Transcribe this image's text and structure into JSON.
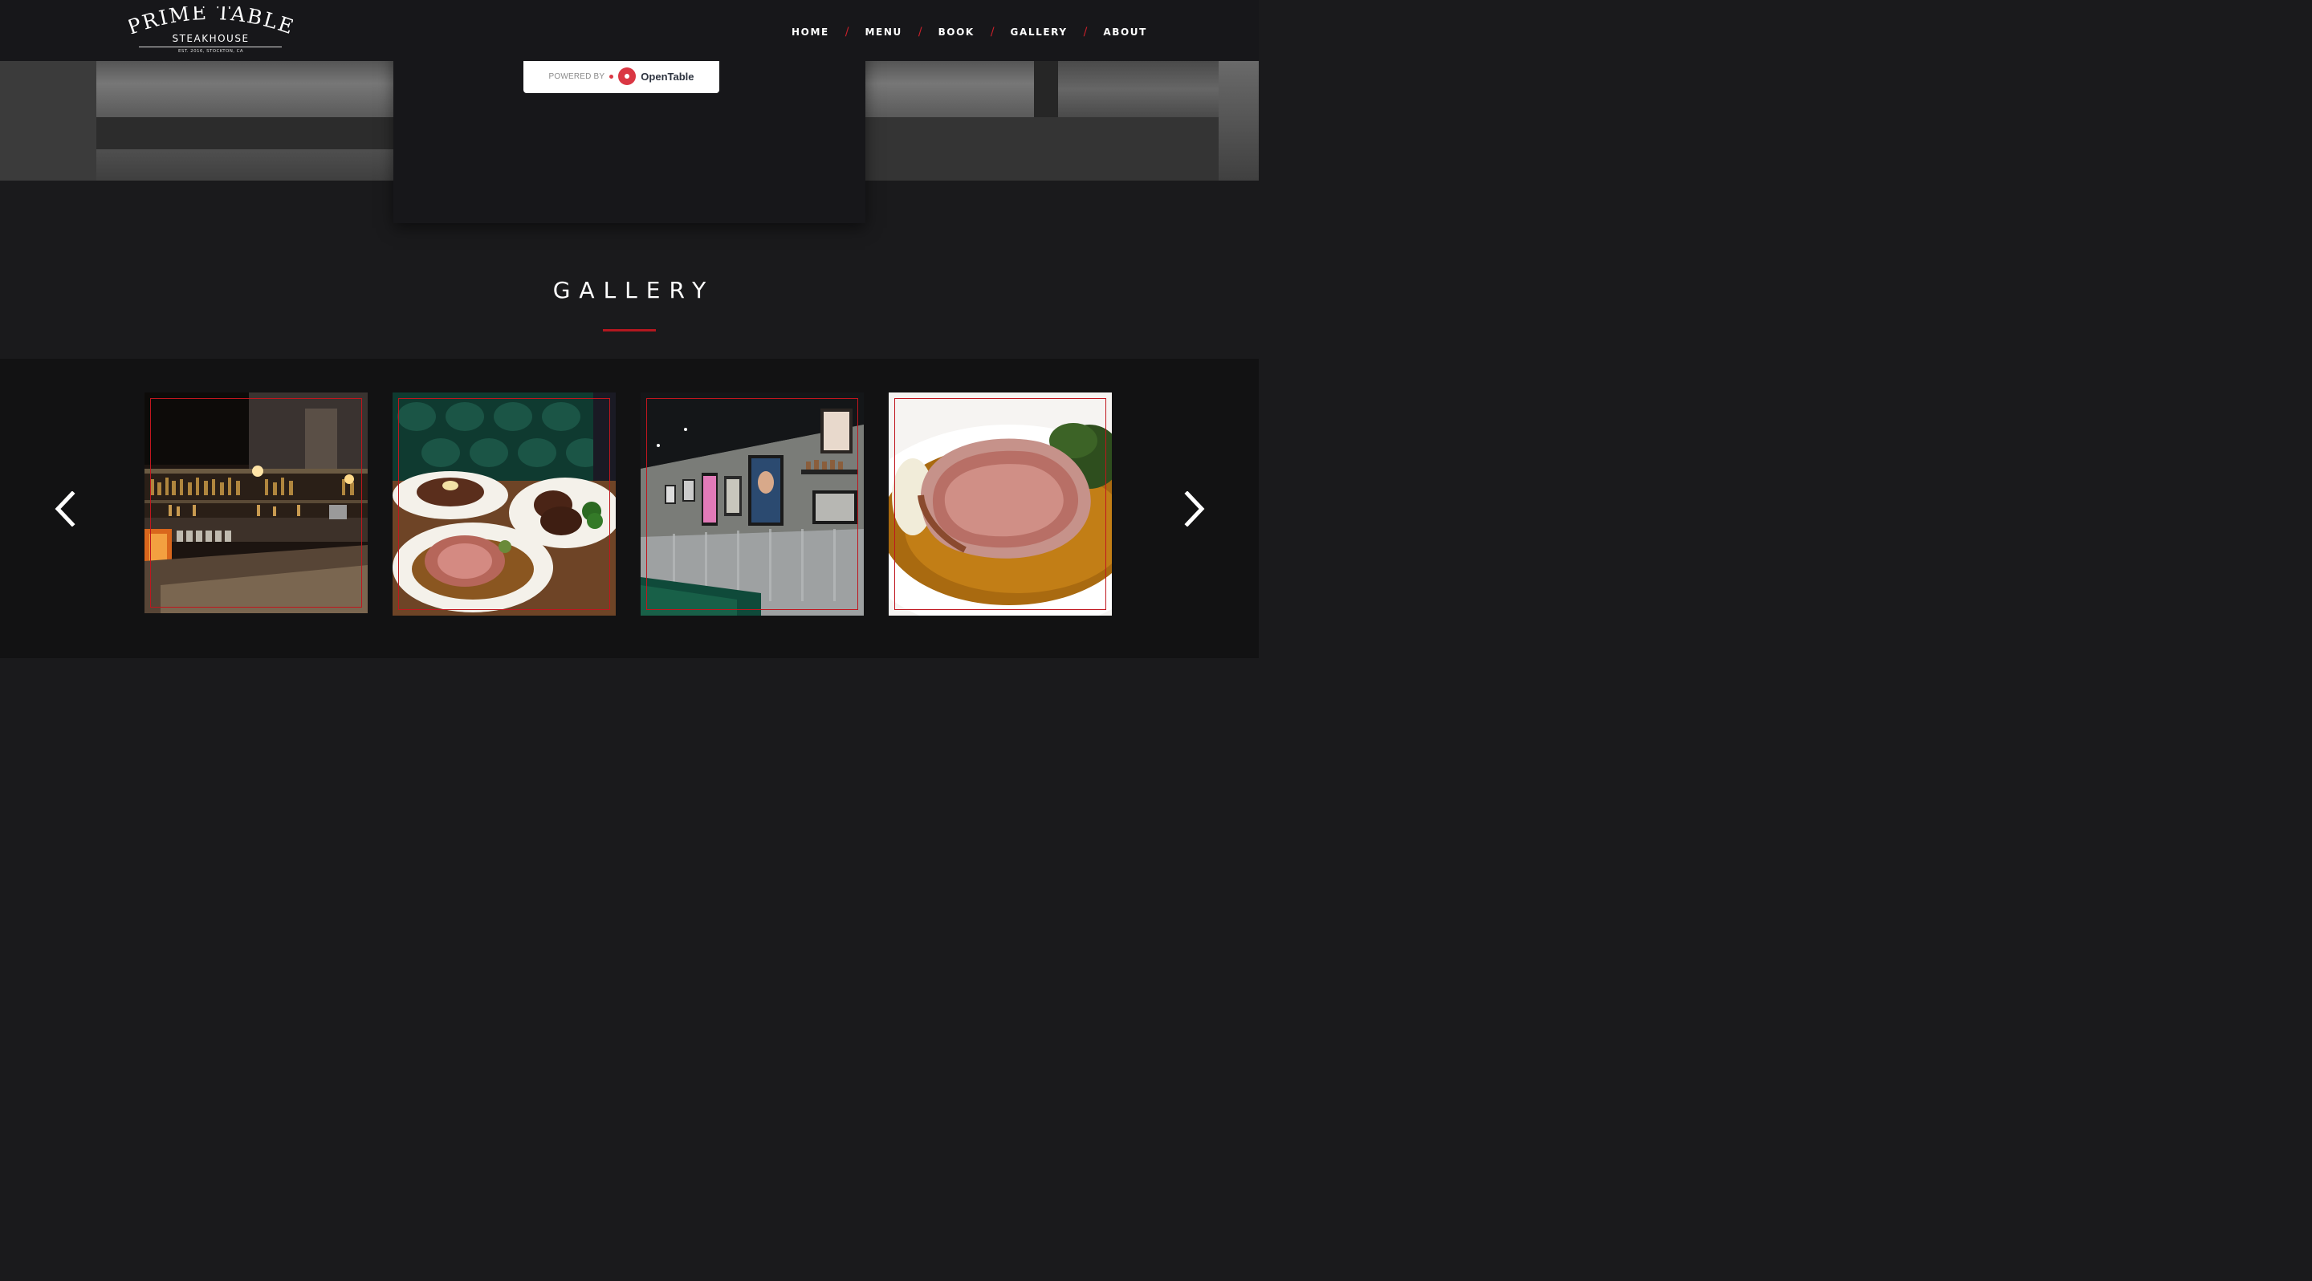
{
  "brand": {
    "name_line1": "PRIME TABLE",
    "name_line2": "STEAKHOUSE",
    "tagline": "EST. 2016, STOCKTON, CA"
  },
  "nav": {
    "items": [
      {
        "label": "HOME"
      },
      {
        "label": "MENU"
      },
      {
        "label": "BOOK"
      },
      {
        "label": "GALLERY"
      },
      {
        "label": "ABOUT"
      }
    ],
    "separator": "/"
  },
  "booking": {
    "powered_by": "POWERED BY",
    "provider": "OpenTable"
  },
  "gallery": {
    "title": "GALLERY",
    "photos": [
      {
        "subject": "bar-interior"
      },
      {
        "subject": "steak-plates"
      },
      {
        "subject": "dining-room-wall"
      },
      {
        "subject": "prime-rib-plate"
      }
    ]
  },
  "colors": {
    "accent": "#c8202a",
    "header_bg": "#17171a",
    "page_bg": "#1a1a1c",
    "carousel_bg": "#121213"
  },
  "icons": {
    "prev": "chevron-left-icon",
    "next": "chevron-right-icon",
    "opentable": "opentable-logo-icon"
  }
}
